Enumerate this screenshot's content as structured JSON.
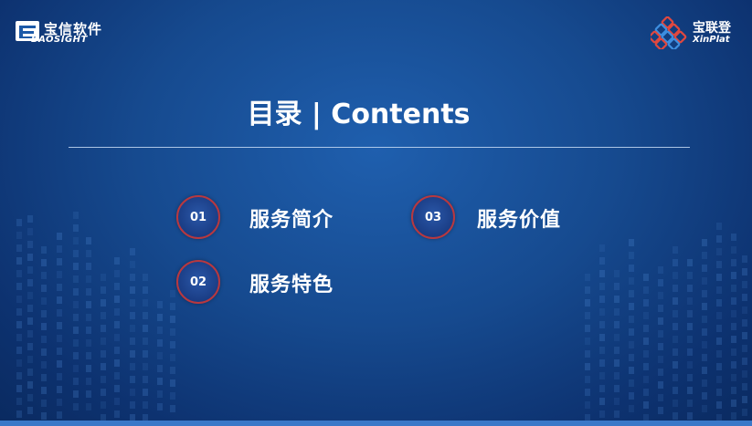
{
  "colors": {
    "background": "#164a8f",
    "badge_border": "#b8383f",
    "text": "#ffffff"
  },
  "header": {
    "left_logo": {
      "cn": "宝信软件",
      "en": "BAOSIGHT"
    },
    "right_logo": {
      "cn": "宝联登",
      "en": "XinPlat"
    }
  },
  "main": {
    "title": "目录 | Contents",
    "items": [
      {
        "num": "01",
        "label": "服务简介"
      },
      {
        "num": "02",
        "label": "服务特色"
      },
      {
        "num": "03",
        "label": "服务价值"
      }
    ]
  }
}
